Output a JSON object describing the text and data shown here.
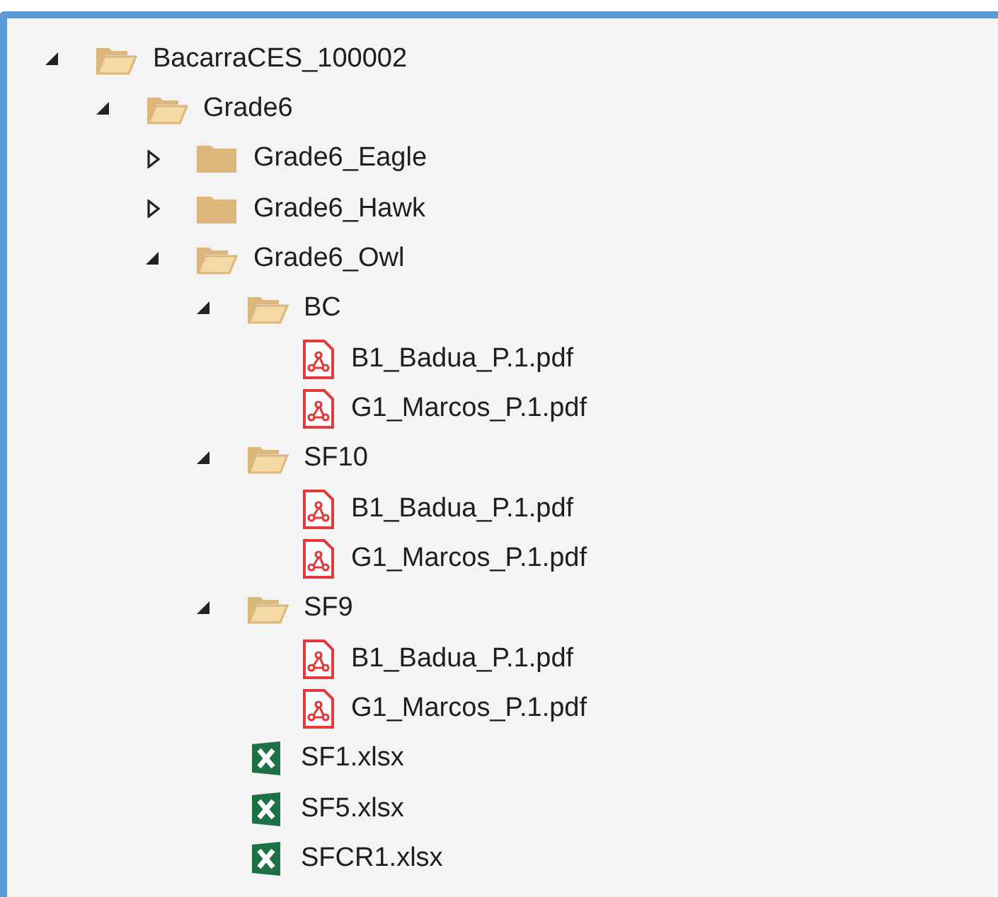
{
  "tree": [
    {
      "label": "BacarraCES_100002",
      "kind": "folder",
      "expanded": true,
      "children": [
        {
          "label": "Grade6",
          "kind": "folder",
          "expanded": true,
          "children": [
            {
              "label": "Grade6_Eagle",
              "kind": "folder",
              "expanded": false
            },
            {
              "label": "Grade6_Hawk",
              "kind": "folder",
              "expanded": false
            },
            {
              "label": "Grade6_Owl",
              "kind": "folder",
              "expanded": true,
              "children": [
                {
                  "label": "BC",
                  "kind": "folder",
                  "expanded": true,
                  "children": [
                    {
                      "label": "B1_Badua_P.1.pdf",
                      "kind": "pdf"
                    },
                    {
                      "label": "G1_Marcos_P.1.pdf",
                      "kind": "pdf"
                    }
                  ]
                },
                {
                  "label": "SF10",
                  "kind": "folder",
                  "expanded": true,
                  "children": [
                    {
                      "label": "B1_Badua_P.1.pdf",
                      "kind": "pdf"
                    },
                    {
                      "label": "G1_Marcos_P.1.pdf",
                      "kind": "pdf"
                    }
                  ]
                },
                {
                  "label": "SF9",
                  "kind": "folder",
                  "expanded": true,
                  "children": [
                    {
                      "label": "B1_Badua_P.1.pdf",
                      "kind": "pdf"
                    },
                    {
                      "label": "G1_Marcos_P.1.pdf",
                      "kind": "pdf"
                    }
                  ]
                },
                {
                  "label": "SF1.xlsx",
                  "kind": "xlsx"
                },
                {
                  "label": "SF5.xlsx",
                  "kind": "xlsx"
                },
                {
                  "label": "SFCR1.xlsx",
                  "kind": "xlsx"
                }
              ]
            }
          ]
        }
      ]
    }
  ]
}
